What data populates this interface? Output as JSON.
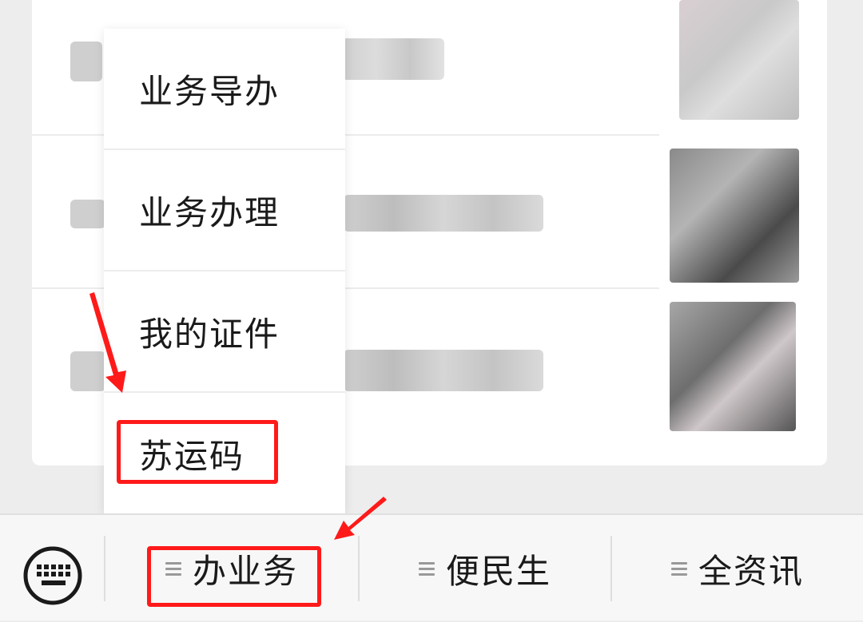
{
  "menu": {
    "items": [
      {
        "label": "业务导办"
      },
      {
        "label": "业务办理"
      },
      {
        "label": "我的证件"
      },
      {
        "label": "苏运码"
      }
    ]
  },
  "bottom_bar": {
    "keyboard_icon": "keyboard-icon",
    "tabs": [
      {
        "label": "办业务",
        "icon": "menu-icon"
      },
      {
        "label": "便民生",
        "icon": "menu-icon"
      },
      {
        "label": "全资讯",
        "icon": "menu-icon"
      }
    ]
  },
  "colors": {
    "highlight": "#ff1a1a",
    "background": "#ededed"
  }
}
